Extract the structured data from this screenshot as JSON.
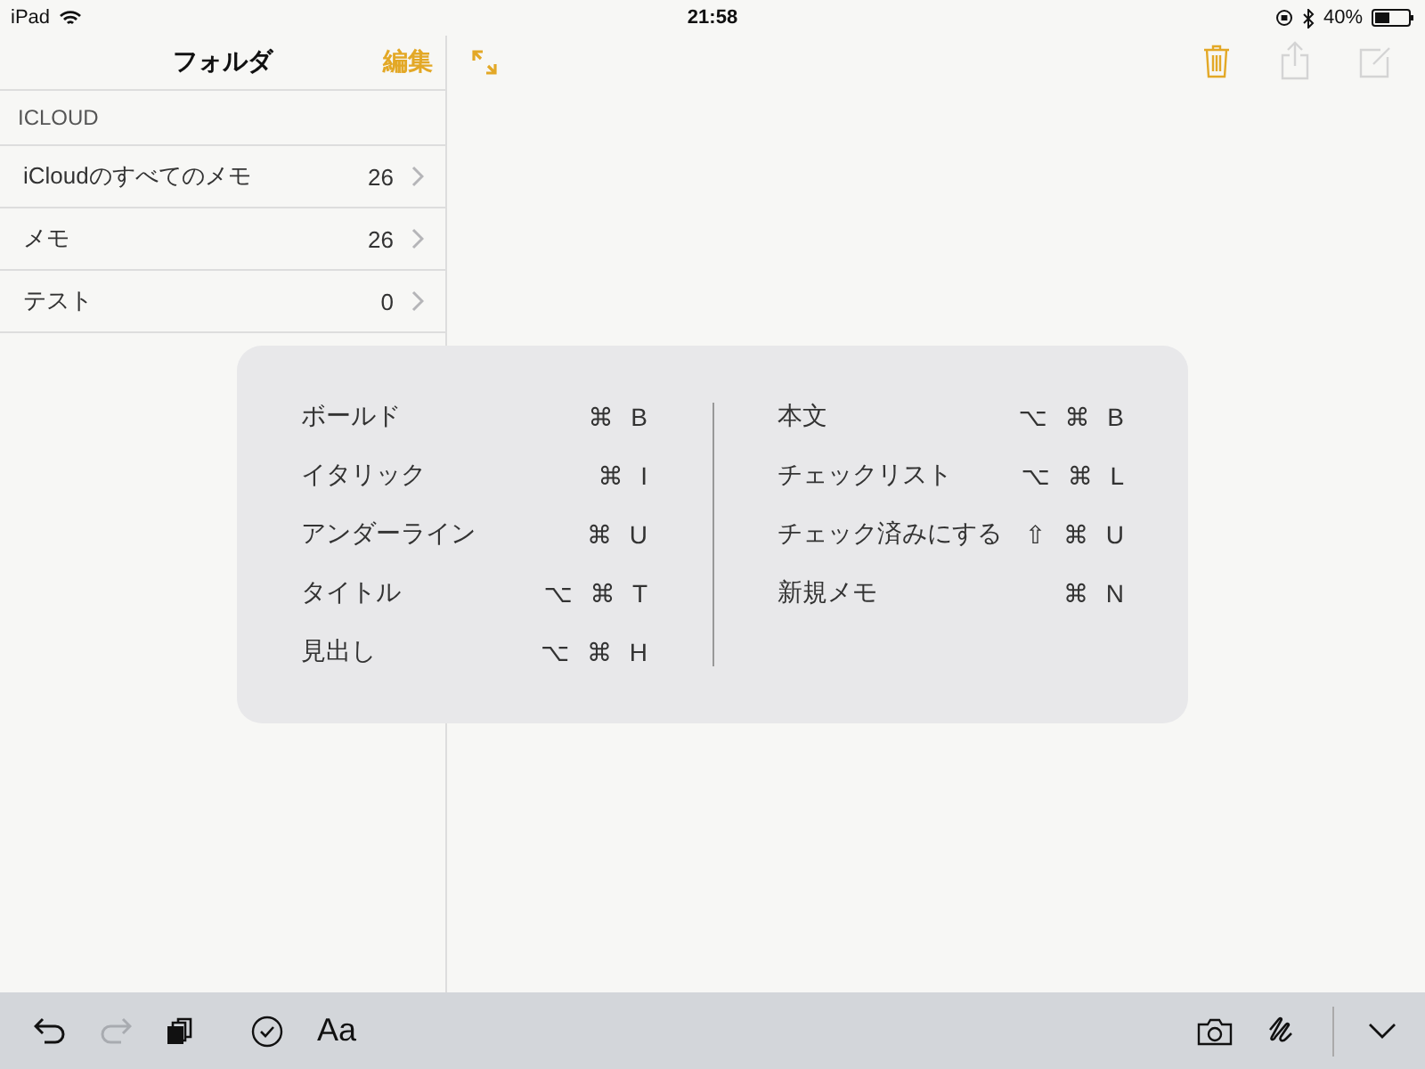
{
  "status_bar": {
    "device": "iPad",
    "time": "21:58",
    "battery": "40%"
  },
  "sidebar": {
    "title": "フォルダ",
    "edit": "編集",
    "section": "ICLOUD",
    "folders": [
      {
        "name": "iCloudのすべてのメモ",
        "count": "26"
      },
      {
        "name": "メモ",
        "count": "26"
      },
      {
        "name": "テスト",
        "count": "0"
      }
    ]
  },
  "shortcuts": {
    "columns": [
      [
        {
          "label": "ボールド",
          "keys": "⌘ B"
        },
        {
          "label": "イタリック",
          "keys": "⌘ I"
        },
        {
          "label": "アンダーライン",
          "keys": "⌘ U"
        },
        {
          "label": "タイトル",
          "keys": "⌥ ⌘ T"
        },
        {
          "label": "見出し",
          "keys": "⌥ ⌘ H"
        }
      ],
      [
        {
          "label": "本文",
          "keys": "⌥ ⌘ B"
        },
        {
          "label": "チェックリスト",
          "keys": "⌥ ⌘ L"
        },
        {
          "label": "チェック済みにする",
          "keys": "⇧ ⌘ U"
        },
        {
          "label": "新規メモ",
          "keys": "⌘ N"
        }
      ]
    ]
  },
  "toolbar": {
    "left": [
      {
        "kind": "undo",
        "disabled": false
      },
      {
        "kind": "redo",
        "disabled": true
      },
      {
        "kind": "copy",
        "disabled": false
      },
      {
        "kind": "checklist",
        "disabled": false
      },
      {
        "kind": "format",
        "label": "Aa",
        "disabled": false
      }
    ],
    "right": [
      {
        "kind": "camera",
        "disabled": false
      },
      {
        "kind": "sketch",
        "disabled": false
      },
      {
        "kind": "collapse",
        "disabled": false
      }
    ]
  }
}
